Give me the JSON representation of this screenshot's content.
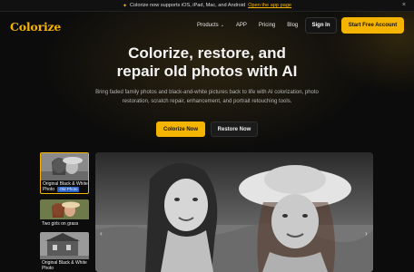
{
  "announcement": {
    "text": "Colorize now supports iOS, iPad, Mac, and Android",
    "link": "Open the app page"
  },
  "nav": {
    "logo": "Colorize",
    "products": "Products",
    "app": "APP",
    "pricing": "Pricing",
    "blog": "Blog",
    "signin": "Sign In",
    "trial": "Start Free Account"
  },
  "hero": {
    "title_line1": "Colorize, restore, and",
    "title_line2": "repair old photos with AI",
    "subtitle": "Bring faded family photos and black-and-white pictures back to life with AI colorization, photo restoration, scratch repair, enhancement, and portrait retouching tools.",
    "cta_primary": "Colorize Now",
    "cta_secondary": "Restore Now"
  },
  "gallery": {
    "thumbnails": [
      {
        "caption": "Original Black & White Photo",
        "badge": "Old Photo"
      },
      {
        "caption": "Two girls on grass"
      },
      {
        "caption": "Original Black & White Photo"
      }
    ]
  },
  "colors": {
    "accent": "#f5b400",
    "background": "#0c0c0c"
  }
}
